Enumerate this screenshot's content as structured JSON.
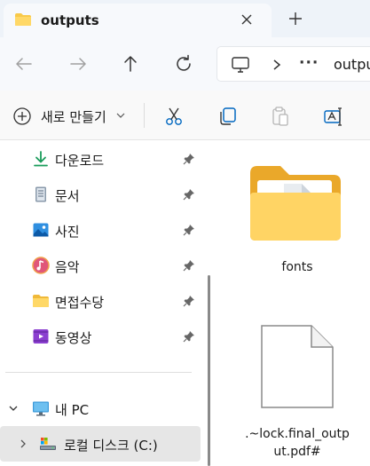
{
  "window": {
    "tab_title": "outputs",
    "tab_icon": "folder-icon",
    "close_tab_icon": "close-icon",
    "new_tab_icon": "plus-icon"
  },
  "navigation": {
    "back_icon": "arrow-left-icon",
    "forward_icon": "arrow-right-icon",
    "up_icon": "arrow-up-icon",
    "refresh_icon": "refresh-icon"
  },
  "address_bar": {
    "location_icon": "computer-icon",
    "separator": ">",
    "overflow": "···",
    "path_text": "outputs"
  },
  "toolbar": {
    "new_label": "새로 만들기",
    "new_icon": "plus-circle-icon",
    "actions": [
      "cut-icon",
      "copy-icon",
      "paste-icon",
      "rename-icon"
    ]
  },
  "sidebar": {
    "quick_access": [
      {
        "label": "다운로드",
        "icon": "download-icon",
        "pinned": true
      },
      {
        "label": "문서",
        "icon": "document-icon",
        "pinned": true
      },
      {
        "label": "사진",
        "icon": "pictures-icon",
        "pinned": true
      },
      {
        "label": "음악",
        "icon": "music-icon",
        "pinned": true
      },
      {
        "label": "면접수당",
        "icon": "folder-icon",
        "pinned": true
      },
      {
        "label": "동영상",
        "icon": "videos-icon",
        "pinned": true
      }
    ],
    "this_pc": {
      "label": "내 PC",
      "icon": "monitor-icon",
      "expanded": true
    },
    "local_disk": {
      "label": "로컬 디스크 (C:)",
      "icon": "drive-icon",
      "selected": true
    }
  },
  "files": [
    {
      "name": "fonts",
      "type": "folder"
    },
    {
      "name_line1": ".~lock.final_outp",
      "name_line2": "ut.pdf#",
      "type": "file"
    }
  ],
  "colors": {
    "folder_yellow": "#f8c94a",
    "accent_blue": "#0067c0",
    "selection": "#e6e6e6"
  }
}
